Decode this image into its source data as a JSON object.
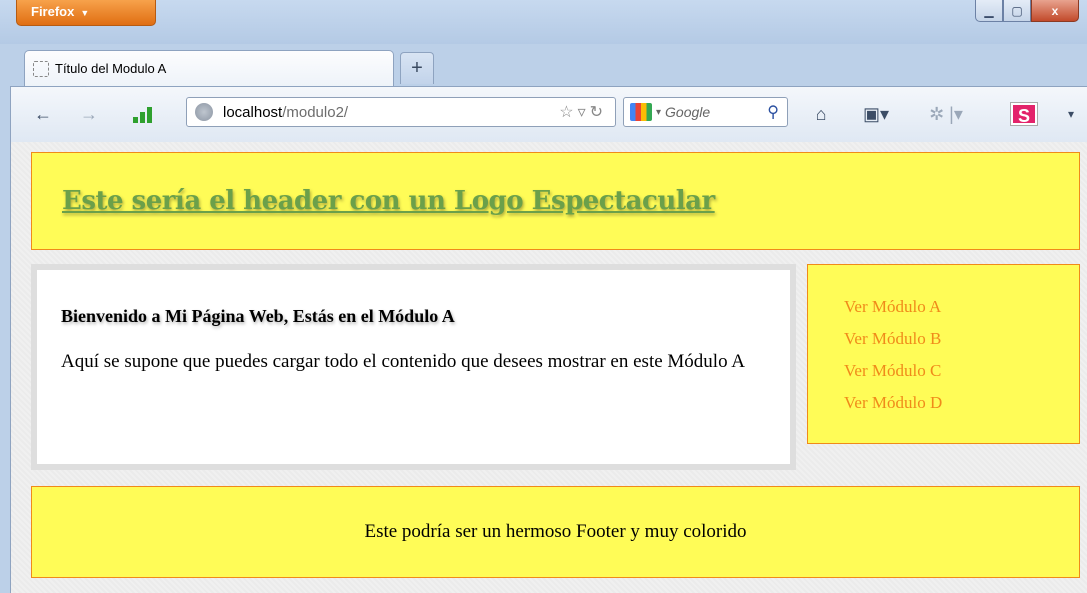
{
  "browser": {
    "menu_label": "Firefox",
    "tab_title": "Título del Modulo A",
    "new_tab_label": "+",
    "url_host": "localhost",
    "url_path": "/modulo2/",
    "search_placeholder": "Google",
    "window_controls": {
      "minimize": "▁",
      "maximize": "▢",
      "close": "x"
    }
  },
  "page": {
    "header_title": "Este sería el header con un Logo Espectacular",
    "content_heading": "Bienvenido a Mi Página Web, Estás en el Módulo A",
    "content_body": "Aquí se supone que puedes cargar todo el contenido que desees mostrar en este Módulo A",
    "sidebar_links": [
      "Ver Módulo A",
      "Ver Módulo B",
      "Ver Módulo C",
      "Ver Módulo D"
    ],
    "footer_text": "Este podría ser un hermoso Footer y muy colorido"
  },
  "colors": {
    "header_bg": "#fffc57",
    "border_orange": "#f08a1a",
    "header_text": "#6ba04a",
    "link": "#f08a1a"
  }
}
